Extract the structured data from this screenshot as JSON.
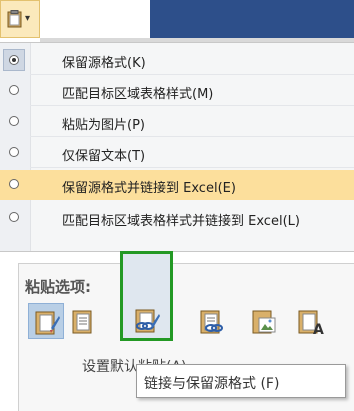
{
  "menu": {
    "items": [
      {
        "label": "保留源格式(K)",
        "selected": true,
        "hover": false
      },
      {
        "label": "匹配目标区域表格样式(M)",
        "selected": false,
        "hover": false
      },
      {
        "label": "粘贴为图片(P)",
        "selected": false,
        "hover": false
      },
      {
        "label": "仅保留文本(T)",
        "selected": false,
        "hover": false
      },
      {
        "label": "保留源格式并链接到 Excel(E)",
        "selected": false,
        "hover": true
      },
      {
        "label": "匹配目标区域表格样式并链接到 Excel(L)",
        "selected": false,
        "hover": false
      }
    ]
  },
  "paste_options": {
    "title": "粘贴选项:",
    "set_default": "设置默认粘贴(A)...",
    "tooltip": "链接与保留源格式 (F)",
    "icons": [
      "keep-source-formatting-icon",
      "use-destination-styles-icon",
      "link-keep-source-icon",
      "link-destination-styles-icon",
      "picture-icon",
      "keep-text-only-icon"
    ]
  },
  "colors": {
    "hover": "#fcdf9c",
    "green_border": "#239924",
    "blue_band": "#2d4f8a"
  }
}
